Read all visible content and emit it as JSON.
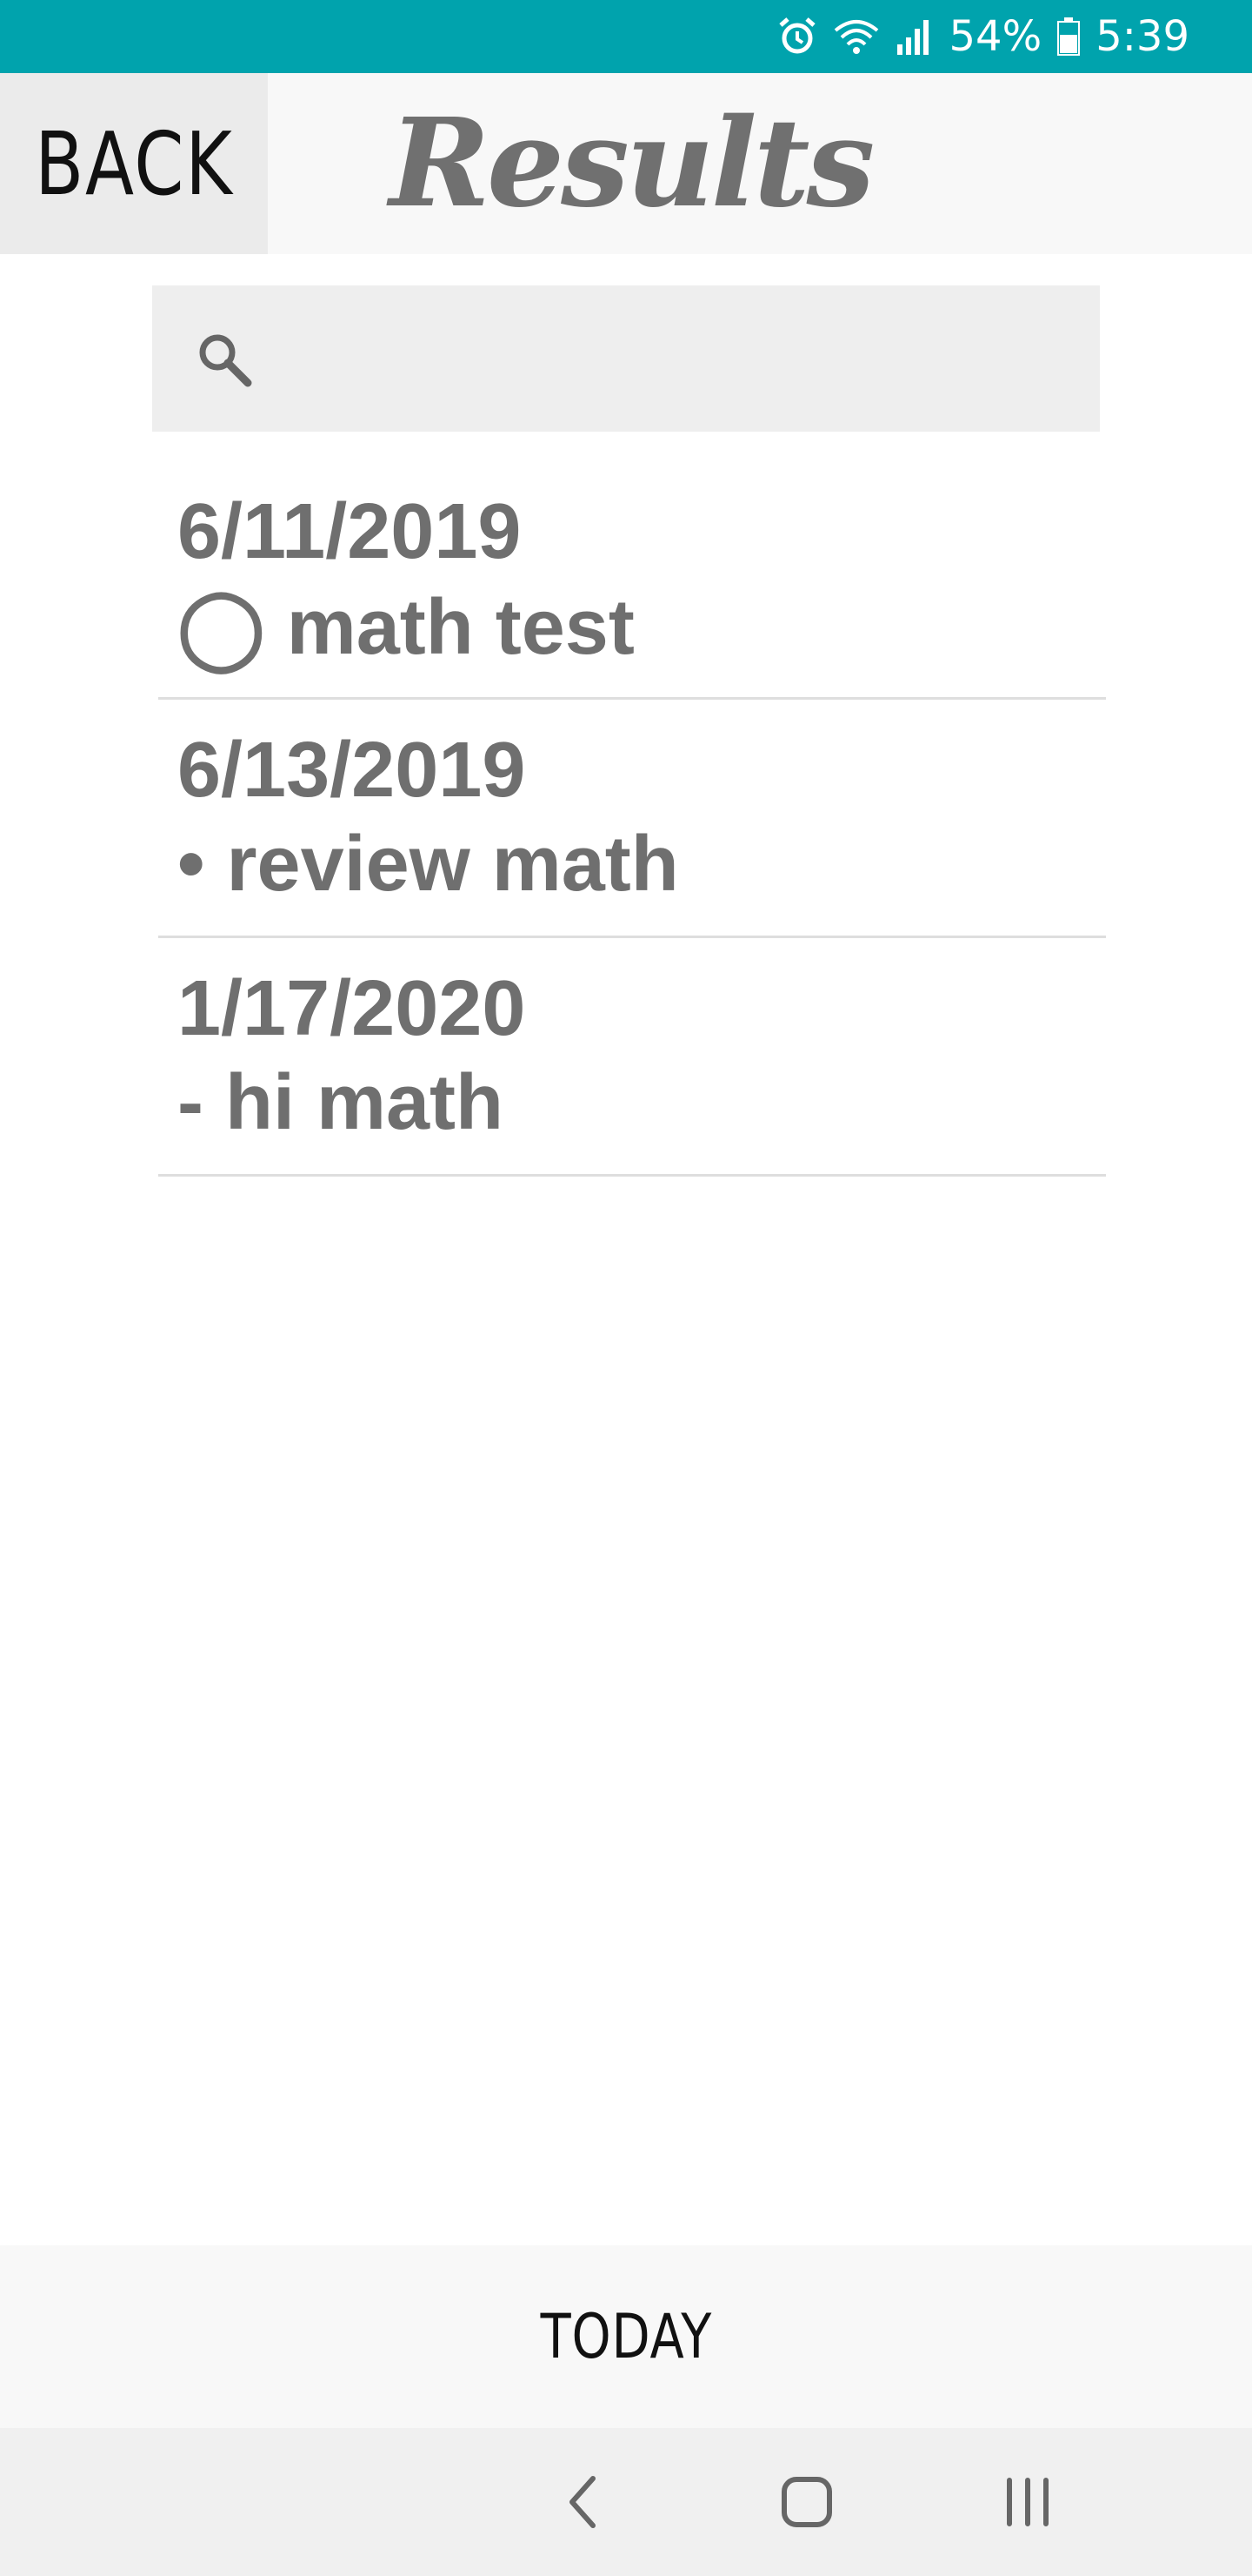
{
  "status_bar": {
    "battery_percent": "54%",
    "time": "5:39",
    "icons": [
      "alarm-icon",
      "wifi-icon",
      "signal-icon",
      "battery-icon"
    ]
  },
  "header": {
    "back_label": "BACK",
    "title": "Results"
  },
  "search": {
    "value": "",
    "icon": "search-icon"
  },
  "results": [
    {
      "date": "6/11/2019",
      "note": "◯ math test"
    },
    {
      "date": "6/13/2019",
      "note": "• review math"
    },
    {
      "date": "1/17/2020",
      "note": "- hi math"
    }
  ],
  "footer": {
    "today_label": "TODAY"
  },
  "nav": {
    "icons": [
      "back-nav-icon",
      "home-nav-icon",
      "recents-nav-icon"
    ]
  },
  "colors": {
    "status_bar": "#00a3ad",
    "text_gray": "#6f6f6f"
  }
}
